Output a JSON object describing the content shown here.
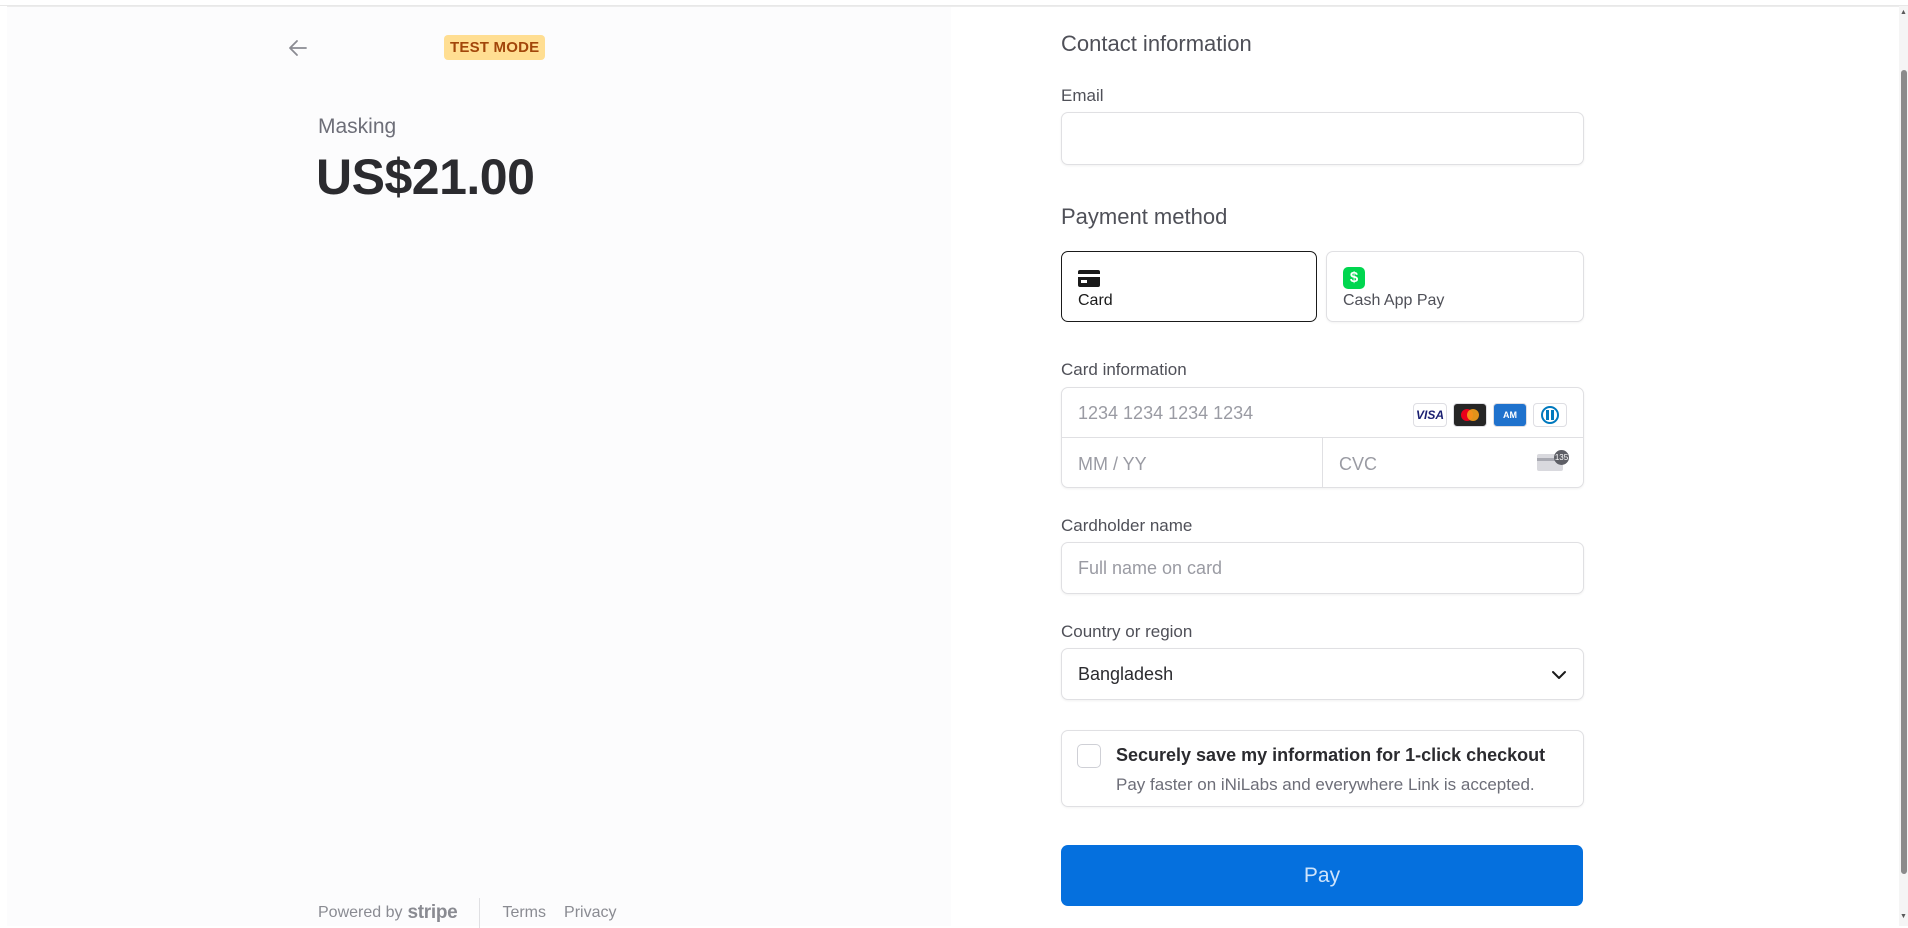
{
  "left": {
    "badge": "TEST MODE",
    "product_name": "Masking",
    "price": "US$21.00",
    "footer": {
      "powered_by": "Powered by",
      "stripe": "stripe",
      "terms": "Terms",
      "privacy": "Privacy"
    }
  },
  "contact": {
    "title": "Contact information",
    "email_label": "Email",
    "email_value": ""
  },
  "payment": {
    "title": "Payment method",
    "methods": [
      {
        "label": "Card",
        "selected": true
      },
      {
        "label": "Cash App Pay",
        "selected": false
      }
    ],
    "cash_app_glyph": "$",
    "card_info_label": "Card information",
    "card_number_placeholder": "1234 1234 1234 1234",
    "expiry_placeholder": "MM / YY",
    "cvc_placeholder": "CVC",
    "cvc_badge": "135",
    "card_brands": [
      "VISA",
      "Mastercard",
      "AMEX",
      "Diners Club"
    ],
    "cardholder_label": "Cardholder name",
    "cardholder_placeholder": "Full name on card",
    "country_label": "Country or region",
    "country_value": "Bangladesh"
  },
  "save_info": {
    "checked": false,
    "title": "Securely save my information for 1-click checkout",
    "subtitle": "Pay faster on iNiLabs and everywhere Link is accepted."
  },
  "pay_button": "Pay",
  "colors": {
    "accent": "#0570de",
    "badge_bg": "#ffde92",
    "badge_text": "#a2460a",
    "cash_app_green": "#00d64f"
  }
}
